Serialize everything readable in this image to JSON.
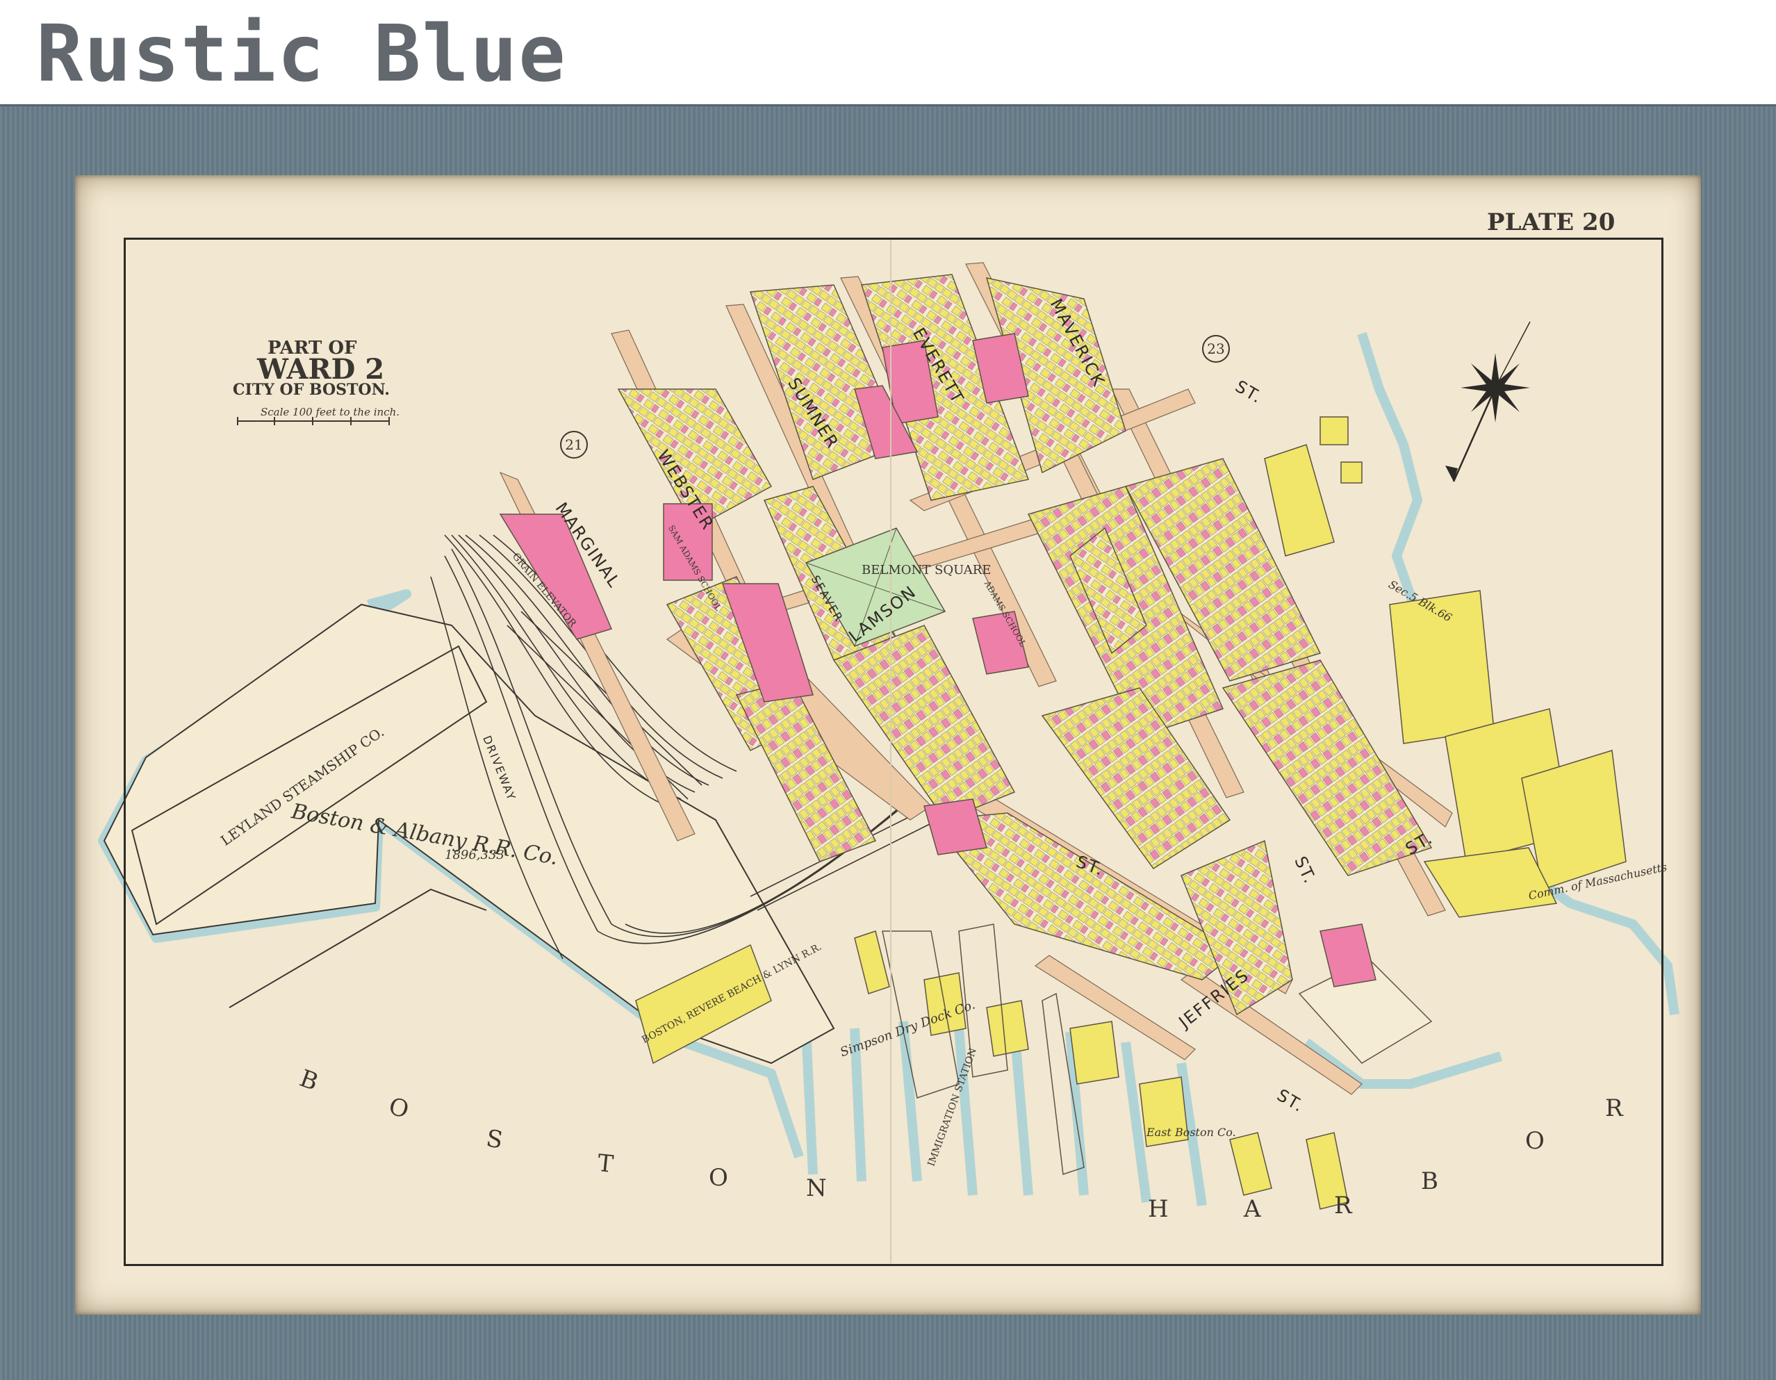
{
  "banner": {
    "title": "Rustic Blue"
  },
  "map": {
    "plate": "PLATE 20",
    "title_part": "PART OF",
    "title_ward": "WARD 2",
    "title_city": "CITY OF BOSTON.",
    "scale": "Scale 100 feet to the inch.",
    "ward_markers": [
      "21",
      "23"
    ],
    "streets": [
      "MARGINAL",
      "WEBSTER",
      "SUMNER",
      "EVERETT",
      "MAVERICK",
      "LAMSON",
      "JEFFRIES",
      "ST.",
      "ST.",
      "ST.",
      "ST.",
      "ST.",
      "SEAVER",
      "DRIVEWAY"
    ],
    "labels": {
      "railroad": "Boston & Albany R.R. Co.",
      "steamship": "LEYLAND STEAMSHIP CO.",
      "area": "1896,333",
      "belmont": "BELMONT SQUARE",
      "grain": "GRAIN ELEVATOR",
      "revere": "BOSTON, REVERE BEACH & LYNN R.R.",
      "dry_dock": "Simpson Dry Dock Co.",
      "immigration": "IMMIGRATION STATION",
      "sam_adams": "SAM ADAMS SCHOOL",
      "adams_school": "ADAMS SCHOOL",
      "east_boston": "East Boston Co.",
      "commonwealth": "Comm. of Massachusetts",
      "sec_5_blk_6": "Sec.5 Blk.66"
    },
    "water_text": {
      "boston": [
        "B",
        "O",
        "S",
        "T",
        "O",
        "N"
      ],
      "harbor": [
        "H",
        "A",
        "R",
        "B",
        "O",
        "R"
      ]
    },
    "colors": {
      "paper": "#f2e7d0",
      "water_edge": "#a9d2d6",
      "brick": "#ee7fa8",
      "wood": "#f1e56a",
      "street_fill": "#efcaa6",
      "frame": "#687d8a"
    }
  }
}
